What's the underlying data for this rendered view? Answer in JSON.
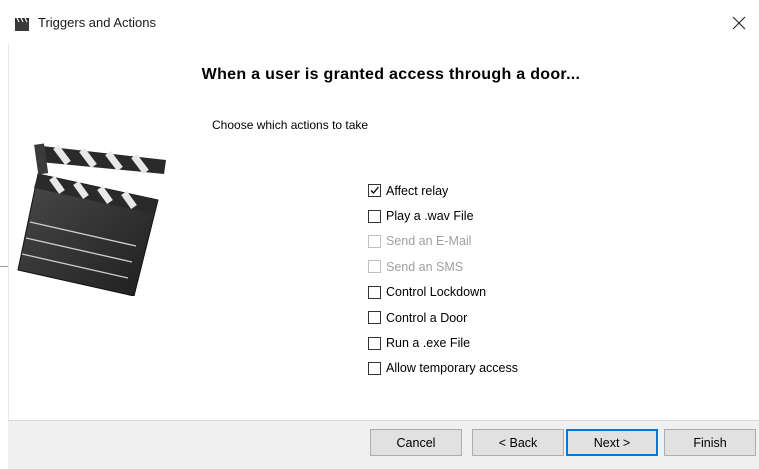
{
  "window": {
    "title": "Triggers and Actions",
    "icon": "clapperboard-icon",
    "close": "close-icon"
  },
  "heading": "When a user is granted access through a door...",
  "subtitle": "Choose which actions to take",
  "illustration": "clapperboard-icon",
  "actions": [
    {
      "label": "Affect relay",
      "checked": true,
      "enabled": true
    },
    {
      "label": "Play a .wav File",
      "checked": false,
      "enabled": true
    },
    {
      "label": "Send an E-Mail",
      "checked": false,
      "enabled": false
    },
    {
      "label": "Send an SMS",
      "checked": false,
      "enabled": false
    },
    {
      "label": "Control Lockdown",
      "checked": false,
      "enabled": true
    },
    {
      "label": "Control a Door",
      "checked": false,
      "enabled": true
    },
    {
      "label": "Run a .exe File",
      "checked": false,
      "enabled": true
    },
    {
      "label": "Allow temporary access",
      "checked": false,
      "enabled": true
    }
  ],
  "buttons": {
    "cancel": "Cancel",
    "back": "< Back",
    "next": "Next >",
    "finish": "Finish"
  },
  "colors": {
    "accent": "#0078d7",
    "footer_bg": "#f0f0f0",
    "disabled_text": "#a0a0a0"
  }
}
